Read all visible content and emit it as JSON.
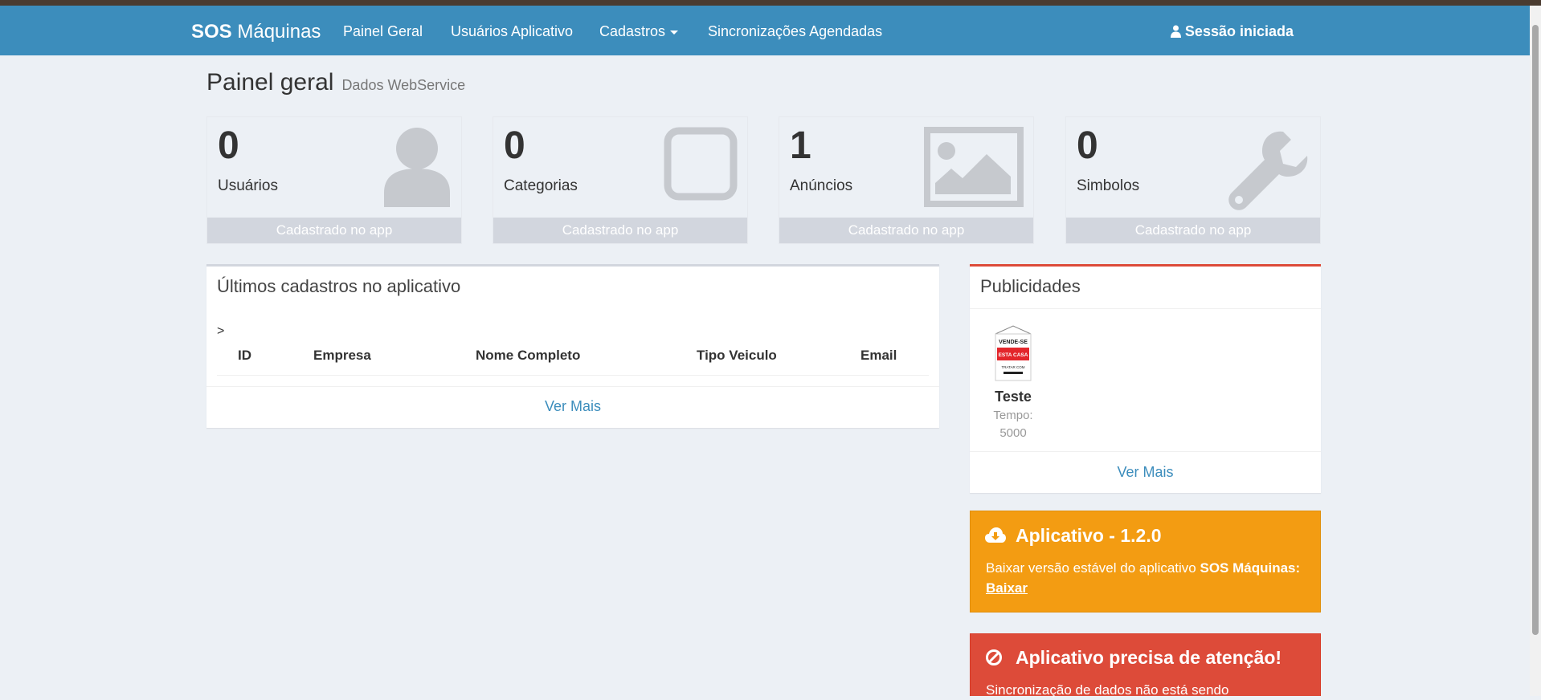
{
  "navbar": {
    "brand_bold": "SOS",
    "brand_rest": " Máquinas",
    "items": [
      "Painel Geral",
      "Usuários Aplicativo",
      "Cadastros",
      "Sincronizações Agendadas"
    ],
    "session": "Sessão iniciada",
    "color": "#3c8dbc"
  },
  "header": {
    "title": "Painel geral",
    "subtitle": "Dados WebService"
  },
  "stats": [
    {
      "value": "0",
      "label": "Usuários",
      "footer": "Cadastrado no app",
      "icon": "user-icon"
    },
    {
      "value": "0",
      "label": "Categorias",
      "footer": "Cadastrado no app",
      "icon": "square-icon"
    },
    {
      "value": "1",
      "label": "Anúncios",
      "footer": "Cadastrado no app",
      "icon": "image-icon"
    },
    {
      "value": "0",
      "label": "Simbolos",
      "footer": "Cadastrado no app",
      "icon": "wrench-icon"
    }
  ],
  "latest": {
    "title": "Últimos cadastros no aplicativo",
    "marker": ">",
    "columns": [
      "ID",
      "Empresa",
      "Nome Completo",
      "Tipo Veiculo",
      "Email"
    ],
    "more": "Ver Mais"
  },
  "ads": {
    "title": "Publicidades",
    "item": {
      "name": "Teste",
      "tempo_label": "Tempo:",
      "tempo_value": "5000",
      "sign_top": "VENDE-SE",
      "sign_mid": "ESTA CASA",
      "sign_bottom": "TRATAR COM"
    },
    "more": "Ver Mais"
  },
  "app_callout": {
    "title": "Aplicativo - 1.2.0",
    "text": "Baixar versão estável do aplicativo ",
    "brand": "SOS Máquinas:",
    "link": "Baixar",
    "color": "#f39c12"
  },
  "alert_callout": {
    "title": "Aplicativo precisa de atenção!",
    "text": "Sincronização de dados não está sendo",
    "color": "#dd4b39"
  }
}
